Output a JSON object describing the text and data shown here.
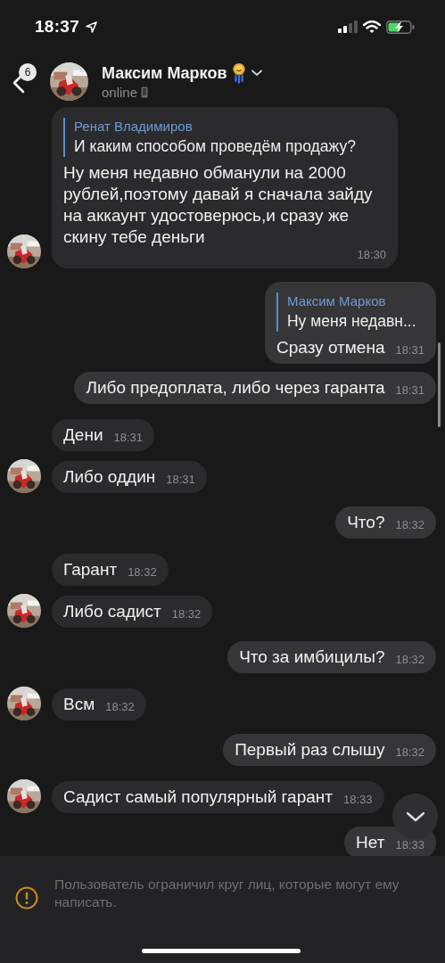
{
  "status_bar": {
    "time": "18:37"
  },
  "header": {
    "back_badge": "6",
    "name": "Максим Марков",
    "status": "online"
  },
  "messages": [
    {
      "kind": "incoming",
      "avatar": true,
      "reply": {
        "author": "Ренат Владимиров",
        "text": "И каким способом проведём продажу?"
      },
      "text": "Ну меня недавно обманули на 2000 рублей,поэтому давай я сначала зайду на аккаунт удостоверюсь,и сразу же скину тебе деньги",
      "time": "18:30"
    },
    {
      "kind": "outgoing",
      "reply": {
        "author": "Максим Марков",
        "text": "Ну меня недавн..."
      },
      "text": "Сразу отмена",
      "time": "18:31"
    },
    {
      "kind": "outgoing",
      "text": "Либо предоплата, либо через гаранта",
      "time": "18:31"
    },
    {
      "kind": "incoming",
      "avatar": false,
      "text": "Дени",
      "time": "18:31"
    },
    {
      "kind": "incoming",
      "avatar": true,
      "text": "Либо оддин",
      "time": "18:31"
    },
    {
      "kind": "outgoing",
      "text": "Что?",
      "time": "18:32"
    },
    {
      "kind": "incoming",
      "avatar": false,
      "text": "Гарант",
      "time": "18:32"
    },
    {
      "kind": "incoming",
      "avatar": true,
      "text": "Либо садист",
      "time": "18:32"
    },
    {
      "kind": "outgoing",
      "text": "Что за имбицилы?",
      "time": "18:32"
    },
    {
      "kind": "incoming",
      "avatar": true,
      "text": "Всм",
      "time": "18:32"
    },
    {
      "kind": "outgoing",
      "text": "Первый раз слышу",
      "time": "18:32"
    },
    {
      "kind": "incoming",
      "avatar": true,
      "text": "Садист самый популярный гарант",
      "time": "18:33"
    },
    {
      "kind": "outgoing",
      "text": "Нет",
      "time": "18:33"
    }
  ],
  "notice": {
    "text": "Пользователь ограничил круг лиц, которые могут ему написать."
  }
}
